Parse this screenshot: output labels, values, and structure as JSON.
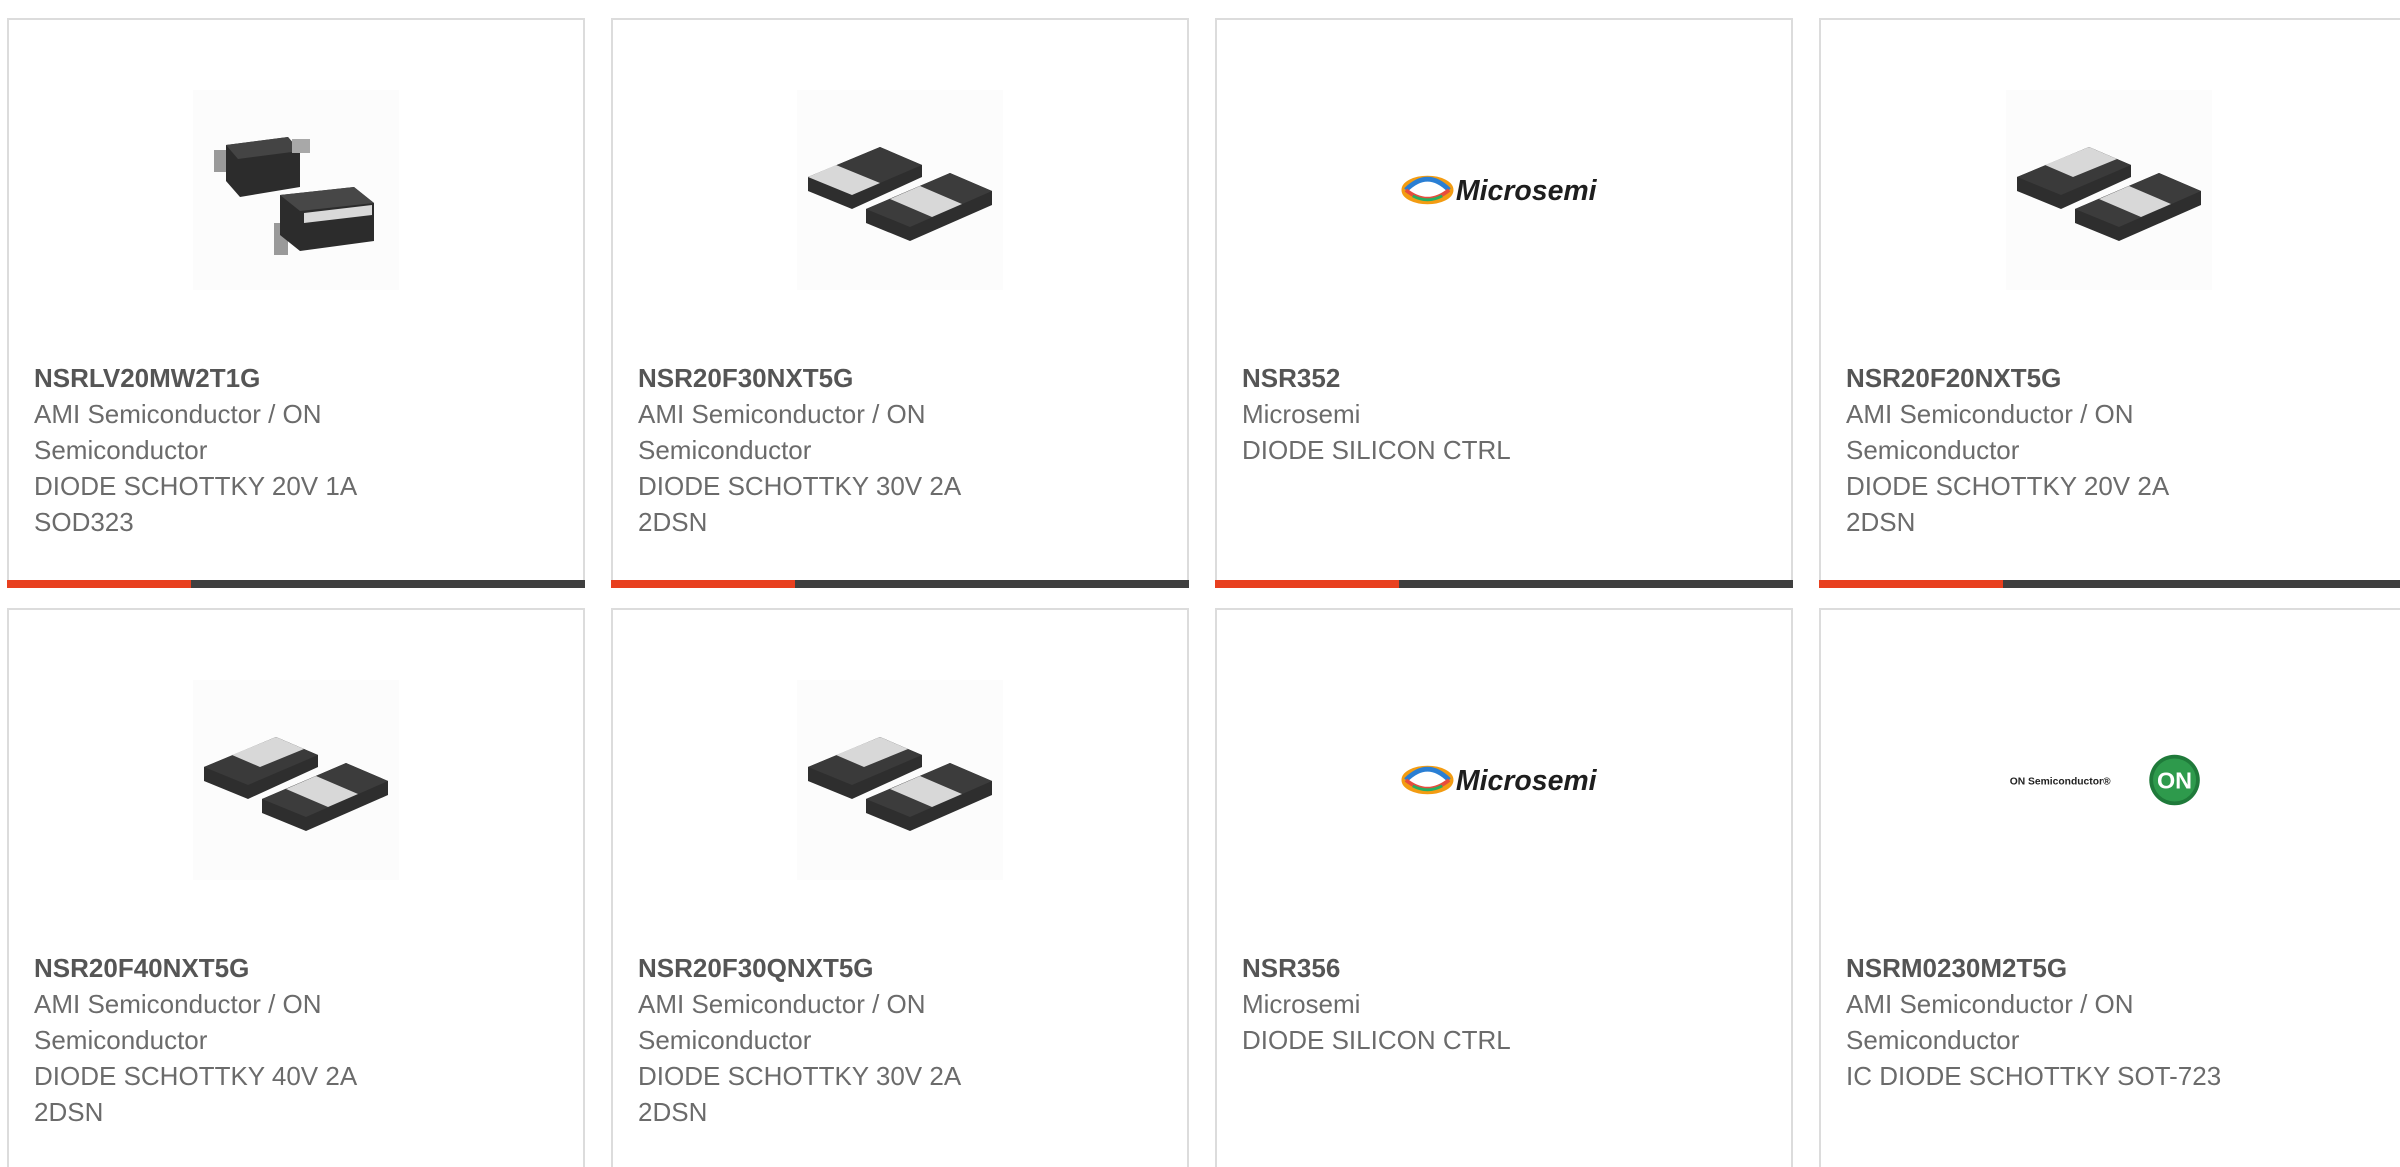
{
  "accent_color": "#e8401f",
  "bar_color": "#3f3f3f",
  "products": [
    {
      "part": "NSRLV20MW2T1G",
      "manufacturer_line1": "AMI Semiconductor / ON",
      "manufacturer_line2": "Semiconductor",
      "desc_line1": "DIODE SCHOTTKY 20V 1A",
      "desc_line2": "SOD323",
      "image": "sod323-package-icon"
    },
    {
      "part": "NSR20F30NXT5G",
      "manufacturer_line1": "AMI Semiconductor / ON",
      "manufacturer_line2": "Semiconductor",
      "desc_line1": "DIODE SCHOTTKY 30V 2A",
      "desc_line2": "2DSN",
      "image": "dsn2-package-icon"
    },
    {
      "part": "NSR352",
      "manufacturer_line1": "Microsemi",
      "manufacturer_line2": "",
      "desc_line1": "DIODE SILICON CTRL",
      "desc_line2": "",
      "image": "microsemi-logo",
      "logo_text": "Microsemi"
    },
    {
      "part": "NSR20F20NXT5G",
      "manufacturer_line1": "AMI Semiconductor / ON",
      "manufacturer_line2": "Semiconductor",
      "desc_line1": "DIODE SCHOTTKY 20V 2A",
      "desc_line2": "2DSN",
      "image": "dsn2-package-icon"
    },
    {
      "part": "NSR20F40NXT5G",
      "manufacturer_line1": "AMI Semiconductor / ON",
      "manufacturer_line2": "Semiconductor",
      "desc_line1": "DIODE SCHOTTKY 40V 2A",
      "desc_line2": "2DSN",
      "image": "dsn2-package-icon"
    },
    {
      "part": "NSR20F30QNXT5G",
      "manufacturer_line1": "AMI Semiconductor / ON",
      "manufacturer_line2": "Semiconductor",
      "desc_line1": "DIODE SCHOTTKY 30V 2A",
      "desc_line2": "2DSN",
      "image": "dsn2-package-icon"
    },
    {
      "part": "NSR356",
      "manufacturer_line1": "Microsemi",
      "manufacturer_line2": "",
      "desc_line1": "DIODE SILICON CTRL",
      "desc_line2": "",
      "image": "microsemi-logo",
      "logo_text": "Microsemi"
    },
    {
      "part": "NSRM0230M2T5G",
      "manufacturer_line1": "AMI Semiconductor / ON",
      "manufacturer_line2": "Semiconductor",
      "desc_line1": "IC DIODE SCHOTTKY SOT-723",
      "desc_line2": "",
      "image": "on-semiconductor-logo",
      "logo_text": "ON Semiconductor®",
      "logo_badge": "ON"
    }
  ]
}
